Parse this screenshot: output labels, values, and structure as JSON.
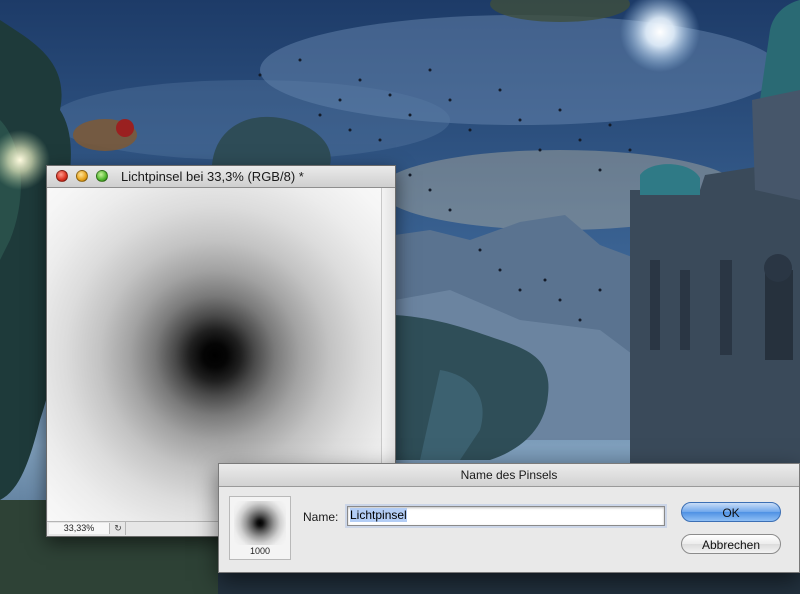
{
  "document_window": {
    "title": "Lichtpinsel bei 33,3% (RGB/8) *",
    "zoom": "33,33%",
    "status_menu_icon": "arrow-circle-icon"
  },
  "dialog": {
    "title": "Name des Pinsels",
    "name_label": "Name:",
    "name_value": "Lichtpinsel",
    "brush_size": "1000",
    "ok_label": "OK",
    "cancel_label": "Abbrechen"
  },
  "colors": {
    "sky_top": "#1e3d6c",
    "ok_button": "#5b9be8"
  }
}
